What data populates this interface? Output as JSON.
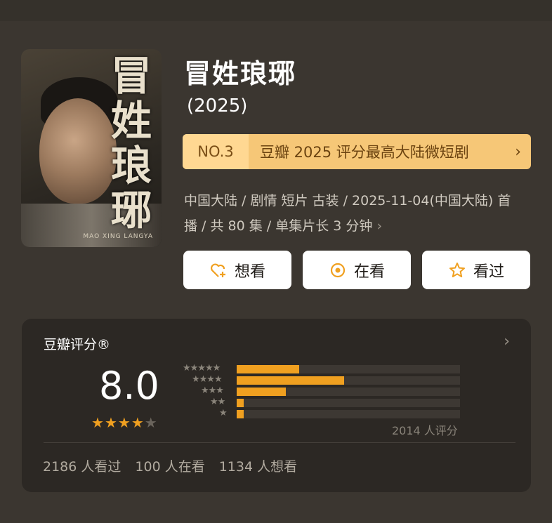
{
  "title": "冒姓琅琊",
  "year": "(2025)",
  "poster": {
    "vertical_title": "冒姓琅琊",
    "sub": "MAO XING LANGYA"
  },
  "rank": {
    "no": "NO.3",
    "text": "豆瓣 2025 评分最高大陆微短剧",
    "chevron": "›"
  },
  "meta_line": "中国大陆 / 剧情 短片 古装 / 2025-11-04(中国大陆) 首播 / 共 80 集 / 单集片长 3 分钟",
  "actions": [
    {
      "label": "想看",
      "icon": "heart-plus-icon"
    },
    {
      "label": "在看",
      "icon": "target-icon"
    },
    {
      "label": "看过",
      "icon": "star-outline-icon"
    }
  ],
  "rating": {
    "label": "豆瓣评分®",
    "score": "8.0",
    "stars": 4,
    "count_text": "2014 人评分",
    "distribution": [
      {
        "stars": "★★★★★",
        "value": 0.28
      },
      {
        "stars": "★★★★",
        "value": 0.48
      },
      {
        "stars": "★★★",
        "value": 0.22
      },
      {
        "stars": "★★",
        "value": 0.03
      },
      {
        "stars": "★",
        "value": 0.03
      }
    ]
  },
  "stats": [
    "2186 人看过",
    "100 人在看",
    "1134 人想看"
  ],
  "colors": {
    "accent": "#f0a020",
    "rank_bg": "#f6c777",
    "bg": "#3b3630",
    "panel": "#2c2824"
  }
}
